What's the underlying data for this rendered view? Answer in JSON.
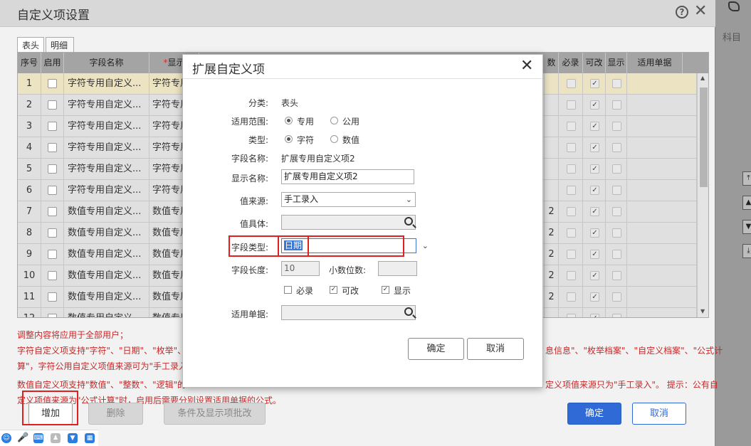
{
  "background": {
    "right_tab_label": "科目"
  },
  "main": {
    "title": "自定义项设置",
    "tabs": [
      "表头",
      "明细"
    ],
    "columns": {
      "seq": "序号",
      "enable": "启用",
      "field_name": "字段名称",
      "display_name": "*显示",
      "digits": "数",
      "required": "必录",
      "editable": "可改",
      "show": "显示",
      "applicable_doc": "适用单据"
    },
    "rows": [
      {
        "seq": "1",
        "field": "字符专用自定义...",
        "display": "字符专用",
        "digits": ""
      },
      {
        "seq": "2",
        "field": "字符专用自定义...",
        "display": "字符专用",
        "digits": ""
      },
      {
        "seq": "3",
        "field": "字符专用自定义...",
        "display": "字符专用",
        "digits": ""
      },
      {
        "seq": "4",
        "field": "字符专用自定义...",
        "display": "字符专用",
        "digits": ""
      },
      {
        "seq": "5",
        "field": "字符专用自定义...",
        "display": "字符专用",
        "digits": ""
      },
      {
        "seq": "6",
        "field": "字符专用自定义...",
        "display": "字符专用",
        "digits": ""
      },
      {
        "seq": "7",
        "field": "数值专用自定义...",
        "display": "数值专用",
        "digits": "2"
      },
      {
        "seq": "8",
        "field": "数值专用自定义...",
        "display": "数值专用",
        "digits": "2"
      },
      {
        "seq": "9",
        "field": "数值专用自定义...",
        "display": "数值专用",
        "digits": "2"
      },
      {
        "seq": "10",
        "field": "数值专用自定义...",
        "display": "数值专用",
        "digits": "2"
      },
      {
        "seq": "11",
        "field": "数值专用自定义...",
        "display": "数值专用",
        "digits": "2"
      },
      {
        "seq": "12",
        "field": "数值专用自定义...",
        "display": "数值专用",
        "digits": ""
      }
    ],
    "notes": [
      "调整内容将应用于全部用户；",
      "字符自定义项支持\"字符\"、\"日期\"、\"枚举\"、\"",
      "算\"，字符公用自定义项值来源可为\"手工录入",
      "数值自定义项支持\"数值\"、\"整数\"、\"逻辑\"的",
      "定义项值来源为\"公式计算\"时，启用后需要分别设置适用单据的公式。"
    ],
    "notes_right": [
      "息信息\"、\"枚举档案\"、\"自定义档案\"、\"公式计",
      "定义项值来源只为\"手工录入\"。 提示：公有自"
    ],
    "buttons": {
      "add": "增加",
      "delete": "删除",
      "batch": "条件及显示项批改",
      "ok": "确定",
      "cancel": "取消"
    }
  },
  "modal": {
    "title": "扩展自定义项",
    "category_label": "分类:",
    "category_value": "表头",
    "scope_label": "适用范围:",
    "scope_options": [
      "专用",
      "公用"
    ],
    "type_label": "类型:",
    "type_options": [
      "字符",
      "数值"
    ],
    "field_name_label": "字段名称:",
    "field_name_value": "扩展专用自定义项2",
    "display_name_label": "显示名称:",
    "display_name_value": "扩展专用自定义项2",
    "value_source_label": "值来源:",
    "value_source_value": "手工录入",
    "value_entity_label": "值具体:",
    "field_type_label": "字段类型:",
    "field_type_value": "日期",
    "field_length_label": "字段长度:",
    "field_length_value": "10",
    "decimal_label": "小数位数:",
    "checkboxes": [
      "必录",
      "可改",
      "显示"
    ],
    "applicable_doc_label": "适用单据:",
    "ok": "确定",
    "cancel": "取消"
  }
}
